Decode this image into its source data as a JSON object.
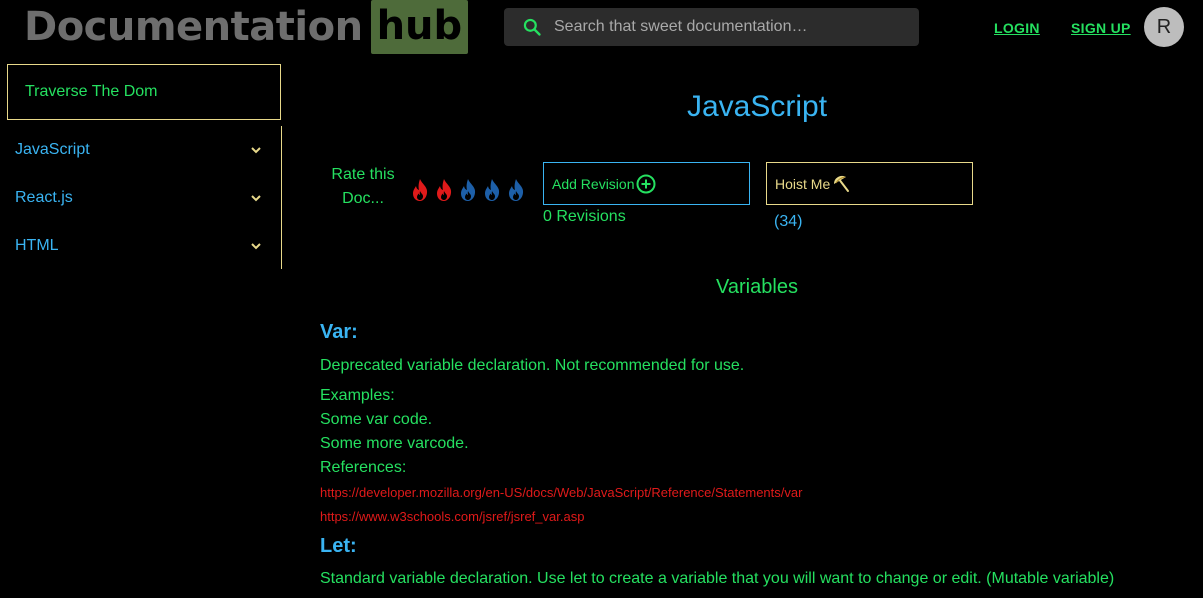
{
  "header": {
    "logo_main": "Documentation",
    "logo_hub": "hub",
    "search_placeholder": "Search that sweet documentation…",
    "login_label": "LOGIN",
    "signup_label": "SIGN UP",
    "avatar_initial": "R"
  },
  "sidebar": {
    "title": "Traverse The Dom",
    "items": [
      {
        "label": "JavaScript"
      },
      {
        "label": "React.js"
      },
      {
        "label": "HTML"
      }
    ]
  },
  "main": {
    "title": "JavaScript",
    "rate_label_line1": "Rate this",
    "rate_label_line2": "Doc...",
    "rating": {
      "value": 2,
      "max": 5
    },
    "add_revision_label": "Add Revision",
    "revisions_count": "0 Revisions",
    "hoist_label": "Hoist Me",
    "hoist_count": "(34)",
    "section_title": "Variables",
    "var_heading": "Var:",
    "var_description": "Deprecated variable declaration. Not recommended for use.",
    "examples_label": "Examples:",
    "examples": [
      "Some var code.",
      "Some more varcode."
    ],
    "references_label": "References:",
    "references": [
      "https://developer.mozilla.org/en-US/docs/Web/JavaScript/Reference/Statements/var",
      "https://www.w3schools.com/jsref/jsref_var.asp"
    ],
    "let_heading": "Let:",
    "let_description": "Standard variable declaration. Use let to create a variable that you will want to change or edit. (Mutable variable)"
  },
  "colors": {
    "green": "#25e060",
    "blue": "#3ab4f2",
    "gold": "#e8d98a",
    "red": "#e01a1a",
    "flame_active": "#e01a1a",
    "flame_inactive": "#1d5fa8"
  }
}
